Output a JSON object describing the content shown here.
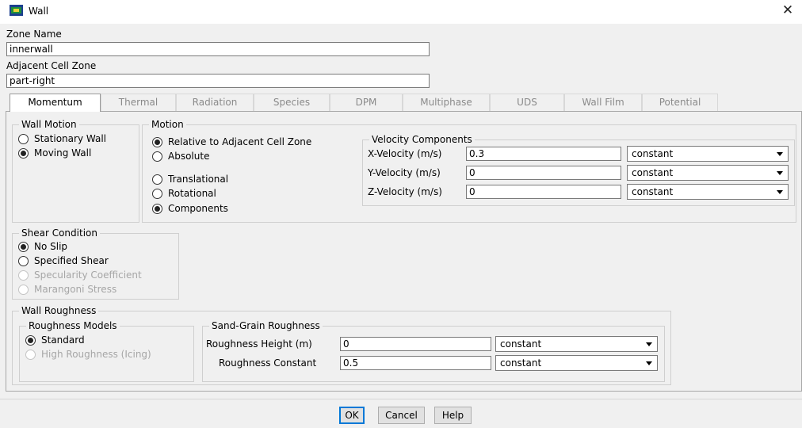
{
  "window": {
    "title": "Wall",
    "icon": "fluent-app-icon",
    "close_icon": "close-icon",
    "close_symbol": "✕"
  },
  "zone_name": {
    "label": "Zone Name",
    "value": "innerwall"
  },
  "adjacent_cell_zone": {
    "label": "Adjacent Cell Zone",
    "value": "part-right"
  },
  "tabs": [
    {
      "label": "Momentum",
      "active": true
    },
    {
      "label": "Thermal",
      "active": false
    },
    {
      "label": "Radiation",
      "active": false
    },
    {
      "label": "Species",
      "active": false
    },
    {
      "label": "DPM",
      "active": false
    },
    {
      "label": "Multiphase",
      "active": false
    },
    {
      "label": "UDS",
      "active": false
    },
    {
      "label": "Wall Film",
      "active": false
    },
    {
      "label": "Potential",
      "active": false
    }
  ],
  "wall_motion": {
    "title": "Wall Motion",
    "options": [
      {
        "label": "Stationary Wall",
        "checked": false
      },
      {
        "label": "Moving Wall",
        "checked": true
      }
    ]
  },
  "motion": {
    "title": "Motion",
    "reference_options": [
      {
        "label": "Relative to Adjacent Cell Zone",
        "checked": true
      },
      {
        "label": "Absolute",
        "checked": false
      }
    ],
    "type_options": [
      {
        "label": "Translational",
        "checked": false
      },
      {
        "label": "Rotational",
        "checked": false
      },
      {
        "label": "Components",
        "checked": true
      }
    ]
  },
  "velocity_components": {
    "title": "Velocity Components",
    "rows": [
      {
        "label": "X-Velocity (m/s)",
        "value": "0.3",
        "method": "constant"
      },
      {
        "label": "Y-Velocity (m/s)",
        "value": "0",
        "method": "constant"
      },
      {
        "label": "Z-Velocity (m/s)",
        "value": "0",
        "method": "constant"
      }
    ]
  },
  "shear_condition": {
    "title": "Shear Condition",
    "options": [
      {
        "label": "No Slip",
        "checked": true,
        "disabled": false
      },
      {
        "label": "Specified Shear",
        "checked": false,
        "disabled": false
      },
      {
        "label": "Specularity Coefficient",
        "checked": false,
        "disabled": true
      },
      {
        "label": "Marangoni Stress",
        "checked": false,
        "disabled": true
      }
    ]
  },
  "wall_roughness": {
    "title": "Wall Roughness",
    "models_title": "Roughness Models",
    "models": [
      {
        "label": "Standard",
        "checked": true,
        "disabled": false
      },
      {
        "label": "High Roughness (Icing)",
        "checked": false,
        "disabled": true
      }
    ],
    "sand_grain_title": "Sand-Grain Roughness",
    "rows": [
      {
        "label": "Roughness Height (m)",
        "value": "0",
        "method": "constant"
      },
      {
        "label": "Roughness Constant",
        "value": "0.5",
        "method": "constant"
      }
    ]
  },
  "buttons": {
    "ok": "OK",
    "cancel": "Cancel",
    "help": "Help"
  },
  "colors": {
    "default_button_border": "#0078d7",
    "dialog_bg": "#f0f0f0"
  }
}
